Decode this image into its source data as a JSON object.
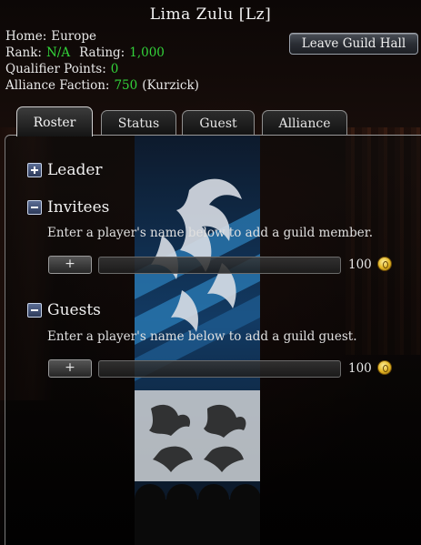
{
  "guild": {
    "title": "Lima Zulu [Lz]",
    "home_label": "Home:",
    "home_value": "Europe",
    "rank_label": "Rank:",
    "rank_value": "N/A",
    "rating_label": "Rating:",
    "rating_value": "1,000",
    "qualifier_label": "Qualifier Points:",
    "qualifier_value": "0",
    "faction_label": "Alliance Faction:",
    "faction_value": "750",
    "faction_side": "(Kurzick)"
  },
  "actions": {
    "leave_label": "Leave Guild Hall"
  },
  "tabs": [
    {
      "label": "Roster",
      "active": true
    },
    {
      "label": "Status",
      "active": false
    },
    {
      "label": "Guest",
      "active": false
    },
    {
      "label": "Alliance",
      "active": false
    }
  ],
  "roster": {
    "leader": {
      "label": "Leader",
      "expanded": false
    },
    "invitees": {
      "label": "Invitees",
      "expanded": true,
      "description": "Enter a player's name below to add a guild member.",
      "add_label": "+",
      "input_value": "",
      "cost": "100"
    },
    "guests": {
      "label": "Guests",
      "expanded": true,
      "description": "Enter a player's name below to add a guild guest.",
      "add_label": "+",
      "input_value": "",
      "cost": "100"
    }
  },
  "colors": {
    "highlight_green": "#33d33a",
    "banner_blue": "#1f5f95",
    "coin_gold": "#e2b320"
  },
  "icons": {
    "collapsed": "plus-box-icon",
    "expanded": "minus-box-icon",
    "currency": "gold-coin-icon"
  }
}
